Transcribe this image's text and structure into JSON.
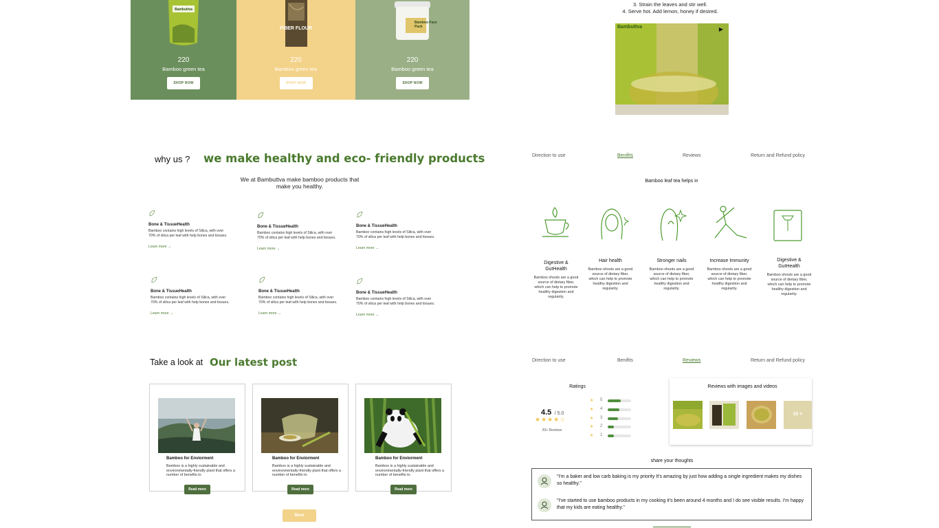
{
  "products": [
    {
      "price": "220",
      "name": "Bamboo green tea",
      "button": "SHOP NOW",
      "bg": "#6b8f5c"
    },
    {
      "price": "220",
      "name": "Bamboo green tea",
      "button": "SHOP NOW",
      "bg": "#f3d289"
    },
    {
      "price": "220",
      "name": "Bamboo green tea",
      "button": "SHOP NOW",
      "bg": "#9aaf86"
    }
  ],
  "product_labels": {
    "pouch2": "FIBER FLOUR",
    "jar": "Bamboo Face Pack",
    "pouch1": "Bambuttva",
    "video_brand": "Bambuttva"
  },
  "steps": [
    "3. Strain the leaves and stir well.",
    "4. Serve hot. Add lemon, honey if desired."
  ],
  "why": {
    "title": "why us ?",
    "headline": "we make healthy and eco- friendly products",
    "description": "We at Bambuttva make bamboo products that make you healthy."
  },
  "features": [
    {
      "name": "Bone & TissueHealth",
      "desc": "Bamboo contains high levels of Silica, with over 70% of silica per leaf with help bones and tissues.",
      "link": "Learn more"
    },
    {
      "name": "Bone & TissueHealth",
      "desc": "Bamboo contains high levels of Silica, with over 70% of silica per leaf with help bones and tissues.",
      "link": "Learn more"
    },
    {
      "name": "Bone & TissueHealth",
      "desc": "Bamboo contains high levels of Silica, with over 70% of silica per leaf with help bones and tissues.",
      "link": "Learn more"
    },
    {
      "name": "Bone & TissueHealth",
      "desc": "Bamboo contains high levels of Silica, with over 70% of silica per leaf with help bones and tissues.",
      "link": "Learn more"
    },
    {
      "name": "Bone & TissueHealth",
      "desc": "Bamboo contains high levels of Silica, with over 70% of silica per leaf with help bones and tissues.",
      "link": "Learn more"
    },
    {
      "name": "Bone & TissueHealth",
      "desc": "Bamboo contains high levels of Silica, with over 70% of silica per leaf with help bones and tissues.",
      "link": "Learn more"
    }
  ],
  "tabs": [
    "Direction to use",
    "Benifits",
    "Reviews",
    "Return and Refund policy"
  ],
  "benefits_heading": "Bamboo leaf tea helps in",
  "benefits": [
    {
      "name": "Digestive & GutHealth",
      "icon": "tea-cup-icon",
      "desc": "Bamboo shoots are a good source of dietary fiber, which can help to promote healthy digestion and regularity."
    },
    {
      "name": "Hair health",
      "icon": "hair-icon",
      "desc": "Bamboo shoots are a good source of dietary fiber, which can help to promote healthy digestion and regularity."
    },
    {
      "name": "Stronger nails",
      "icon": "nails-icon",
      "desc": "Bamboo shoots are a good source of dietary fiber, which can help to promote healthy digestion and regularity."
    },
    {
      "name": "Increase Immunity",
      "icon": "yoga-icon",
      "desc": "Bamboo shoots are a good source of dietary fiber, which can help to promote healthy digestion and regularity."
    },
    {
      "name": "Digestive & GutHealth",
      "icon": "scale-icon",
      "desc": "Bamboo shoots are a good source of dietary fiber, which can help to promote healthy digestion and regularity."
    }
  ],
  "posts": {
    "prefix": "Take a look at",
    "headline": "Our latest post",
    "items": [
      {
        "title": "Bamboo for Enviorment",
        "text": "Bamboo is a highly sustainable and environmentally-friendly plant that offers a number of benefits to",
        "button": "Read more"
      },
      {
        "title": "Bamboo for Enviorment",
        "text": "Bamboo is a highly sustainable and environmentally-friendly plant that offers a number of benefits to",
        "button": "Read more"
      },
      {
        "title": "Bamboo for Enviorment",
        "text": "Bamboo is a highly sustainable and environmentally-friendly plant that offers a number of benefits to",
        "button": "Read more"
      }
    ],
    "more_button": "More"
  },
  "ratings": {
    "title": "Ratings",
    "score": "4.5",
    "out_of": "/ 5.0",
    "count": "20+ Reviews",
    "levels": [
      {
        "label": "5",
        "fill": 0.55
      },
      {
        "label": "4",
        "fill": 0.5
      },
      {
        "label": "3",
        "fill": 0.45
      },
      {
        "label": "2",
        "fill": 0.25
      },
      {
        "label": "1",
        "fill": 0.25
      }
    ],
    "media_title": "Reviews with images and videos",
    "more_media": "10 +"
  },
  "thoughts": {
    "title": "share your thoughts",
    "comments": [
      "\"I'm a baker and low carb baking is my priority It's amazing by just how adding a single ingredient makes my dishes so healthy.\"",
      "\"I've started to use bamboo products in my cooking it's been around 4 months and I do see visible results. I'm happy that my kids are eating healthy.\""
    ]
  },
  "colors": {
    "accent": "#4a7a2e",
    "more_button": "#f3d289"
  }
}
